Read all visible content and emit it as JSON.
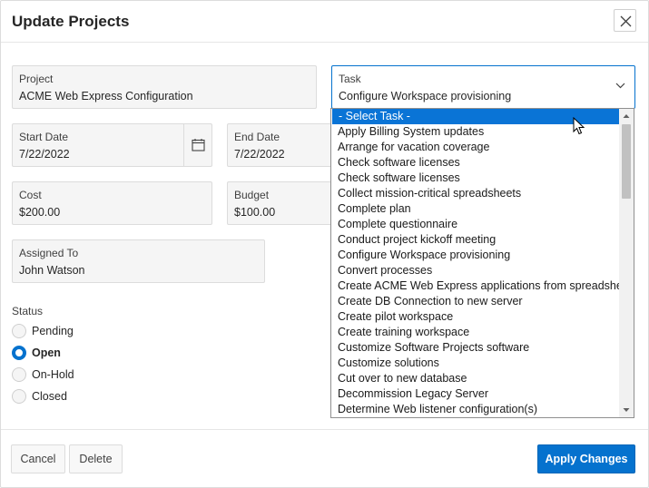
{
  "dialog": {
    "title": "Update Projects",
    "close_icon": "close-icon"
  },
  "form": {
    "project": {
      "label": "Project",
      "value": "ACME Web Express Configuration"
    },
    "task": {
      "label": "Task",
      "value": "Configure Workspace provisioning"
    },
    "start_date": {
      "label": "Start Date",
      "value": "7/22/2022",
      "icon": "calendar-icon"
    },
    "end_date": {
      "label": "End Date",
      "value": "7/22/2022"
    },
    "cost": {
      "label": "Cost",
      "value": "$200.00"
    },
    "budget": {
      "label": "Budget",
      "value": "$100.00"
    },
    "assigned_to": {
      "label": "Assigned To",
      "value": "John Watson"
    },
    "status": {
      "label": "Status",
      "options": [
        "Pending",
        "Open",
        "On-Hold",
        "Closed"
      ],
      "selected": "Open"
    }
  },
  "task_dropdown": {
    "options": [
      "- Select Task -",
      "Apply Billing System updates",
      "Arrange for vacation coverage",
      "Check software licenses",
      "Check software licenses",
      "Collect mission-critical spreadsheets",
      "Complete plan",
      "Complete questionnaire",
      "Conduct project kickoff meeting",
      "Configure Workspace provisioning",
      "Convert processes",
      "Create ACME Web Express applications from spreadsheets",
      "Create DB Connection to new server",
      "Create pilot workspace",
      "Create training workspace",
      "Customize Software Projects software",
      "Customize solutions",
      "Cut over to new database",
      "Decommission Legacy Server",
      "Determine Web listener configuration(s)"
    ],
    "highlighted": "- Select Task -"
  },
  "footer": {
    "cancel_label": "Cancel",
    "delete_label": "Delete",
    "apply_label": "Apply Changes"
  },
  "colors": {
    "accent": "#0572ce",
    "highlight": "#0a74d6"
  }
}
